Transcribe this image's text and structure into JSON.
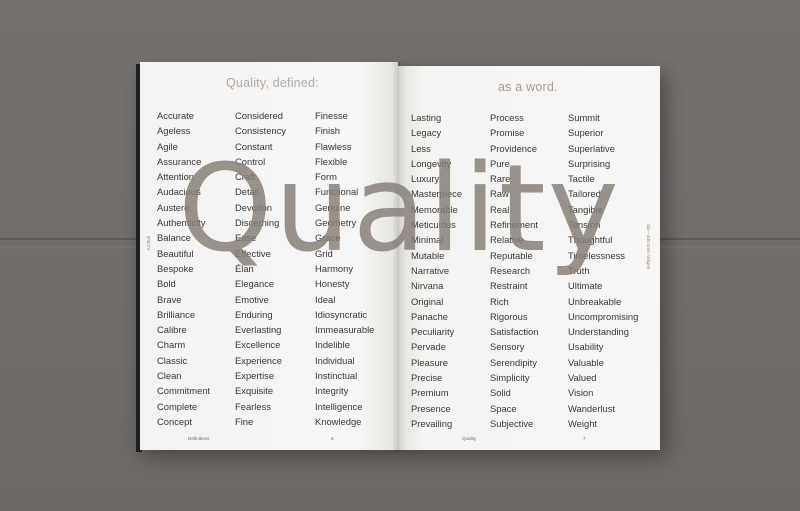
{
  "left_page": {
    "heading": "Quality, defined:",
    "side_label": "AJ Bull",
    "footer_title": "Definitions",
    "footer_page": "6",
    "columns": [
      [
        "Accurate",
        "Ageless",
        "Agile",
        "Assurance",
        "Attention",
        "Audacious",
        "Austere",
        "Authenticity",
        "Balance",
        "Beautiful",
        "Bespoke",
        "Bold",
        "Brave",
        "Brilliance",
        "Calibre",
        "Charm",
        "Classic",
        "Clean",
        "Commitment",
        "Complete",
        "Concept"
      ],
      [
        "Considered",
        "Consistency",
        "Constant",
        "Control",
        "Craft",
        "Detail",
        "Devotion",
        "Discerning",
        "Ease",
        "Effective",
        "Élan",
        "Elegance",
        "Emotive",
        "Enduring",
        "Everlasting",
        "Excellence",
        "Experience",
        "Expertise",
        "Exquisite",
        "Fearless",
        "Fine"
      ],
      [
        "Finesse",
        "Finish",
        "Flawless",
        "Flexible",
        "Form",
        "Functional",
        "Genuine",
        "Geometry",
        "Grace",
        "Grid",
        "Harmony",
        "Honesty",
        "Ideal",
        "Idiosyncratic",
        "Immeasurable",
        "Indelible",
        "Individual",
        "Instinctual",
        "Integrity",
        "Intelligence",
        "Knowledge"
      ]
    ]
  },
  "right_page": {
    "heading": "as a word.",
    "side_label": "Six—100 Gem Wiigen",
    "footer_title": "Quality",
    "footer_page": "7",
    "columns": [
      [
        "Lasting",
        "Legacy",
        "Less",
        "Longevity",
        "Luxury",
        "Masterpiece",
        "Memorable",
        "Meticulous",
        "Minimal",
        "Mutable",
        "Narrative",
        "Nirvana",
        "Original",
        "Panache",
        "Peculiarity",
        "Pervade",
        "Pleasure",
        "Precise",
        "Premium",
        "Presence",
        "Prevailing"
      ],
      [
        "Process",
        "Promise",
        "Providence",
        "Pure",
        "Rare",
        "Raw",
        "Real",
        "Refinement",
        "Relative",
        "Reputable",
        "Research",
        "Restraint",
        "Rich",
        "Rigorous",
        "Satisfaction",
        "Sensory",
        "Serendipity",
        "Simplicity",
        "Solid",
        "Space",
        "Subjective"
      ],
      [
        "Summit",
        "Superior",
        "Superlative",
        "Surprising",
        "Tactile",
        "Tailored",
        "Tangible",
        "Tension",
        "Thoughtful",
        "Timelessness",
        "Truth",
        "Ultimate",
        "Unbreakable",
        "Uncompromising",
        "Understanding",
        "Usability",
        "Valuable",
        "Valued",
        "Vision",
        "Wanderlust",
        "Weight"
      ]
    ]
  },
  "overlay": {
    "word": "Quality",
    "color": "#847c74"
  },
  "colors": {
    "table": "#6f6b69",
    "paper": "#f6f5f3",
    "text": "#3a3836",
    "heading": "#b3aca4"
  }
}
